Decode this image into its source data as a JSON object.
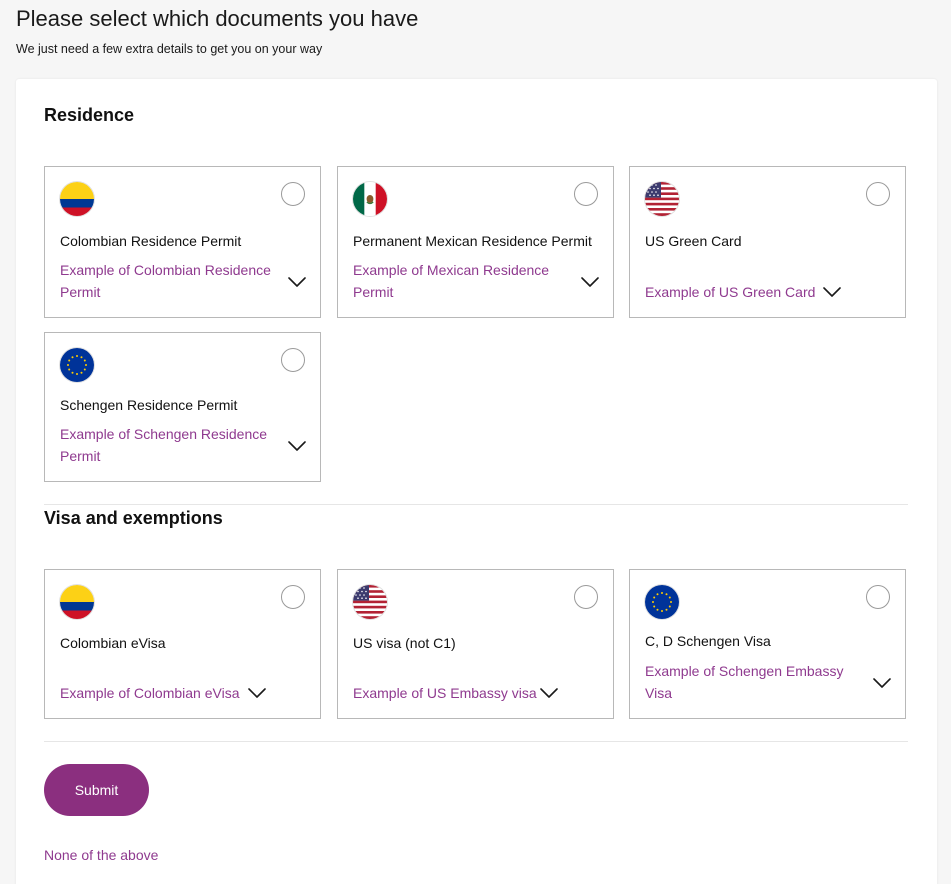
{
  "header": {
    "title": "Please select which documents you have",
    "subtitle": "We just need a few extra details to get you on your way"
  },
  "sections": [
    {
      "title": "Residence",
      "cards": [
        {
          "flag": "colombia-flag-icon",
          "title": "Colombian Residence Permit",
          "example": "Example of Colombian Residence Permit"
        },
        {
          "flag": "mexico-flag-icon",
          "title": "Permanent Mexican Residence Permit",
          "example": "Example of Mexican Residence Permit"
        },
        {
          "flag": "usa-flag-icon",
          "title": "US Green Card",
          "example": "Example of US Green Card"
        },
        {
          "flag": "eu-flag-icon",
          "title": "Schengen Residence Permit",
          "example": "Example of Schengen Residence Permit"
        }
      ]
    },
    {
      "title": "Visa and exemptions",
      "cards": [
        {
          "flag": "colombia-flag-icon",
          "title": "Colombian eVisa",
          "example": "Example of Colombian eVisa"
        },
        {
          "flag": "usa-flag-icon",
          "title": "US visa (not C1)",
          "example": "Example of US Embassy visa"
        },
        {
          "flag": "eu-flag-icon",
          "title": "C, D Schengen Visa",
          "example": "Example of Schengen Embassy Visa"
        }
      ]
    }
  ],
  "actions": {
    "submit_label": "Submit",
    "none_label": "None of the above"
  },
  "colors": {
    "accent": "#8b2f7f",
    "link": "#8f3a8f",
    "card_border": "#b8b8b8"
  }
}
